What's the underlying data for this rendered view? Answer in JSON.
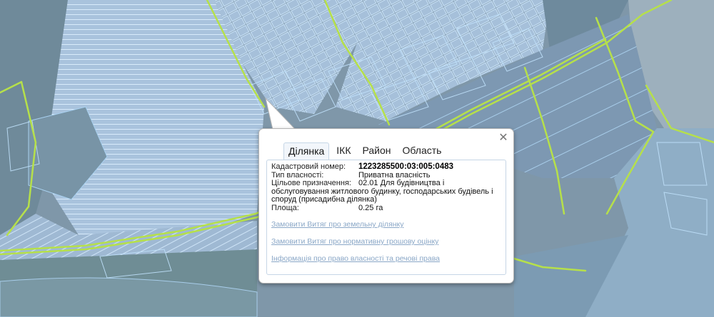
{
  "popup": {
    "close_icon": "close-icon",
    "tabs": [
      "Ділянка",
      "ІКК",
      "Район",
      "Область"
    ],
    "active_tab": "Ділянка",
    "fields": {
      "cadastral_label": "Кадастровий номер:",
      "cadastral_value": "1223285500:03:005:0483",
      "ownership_label": "Тип власності:",
      "ownership_value": "Приватна власність",
      "purpose_label": "Цільове призначення:",
      "purpose_value_line1": "02.01 Для будівництва і",
      "purpose_value_rest": "обслуговування житлового будинку, господарських будівель і споруд (присадибна ділянка)",
      "area_label": "Площа:",
      "area_value": "0.25 га"
    },
    "links": [
      "Замовити Витяг про земельну ділянку",
      "Замовити Витяг про нормативну грошову оцінку",
      "Інформація про право власності та речові права"
    ]
  },
  "map": {
    "boundary_color": "#b6e04a",
    "parcel_stroke": "#8ec7ef",
    "parcel_fill": "#a9c6e2"
  }
}
